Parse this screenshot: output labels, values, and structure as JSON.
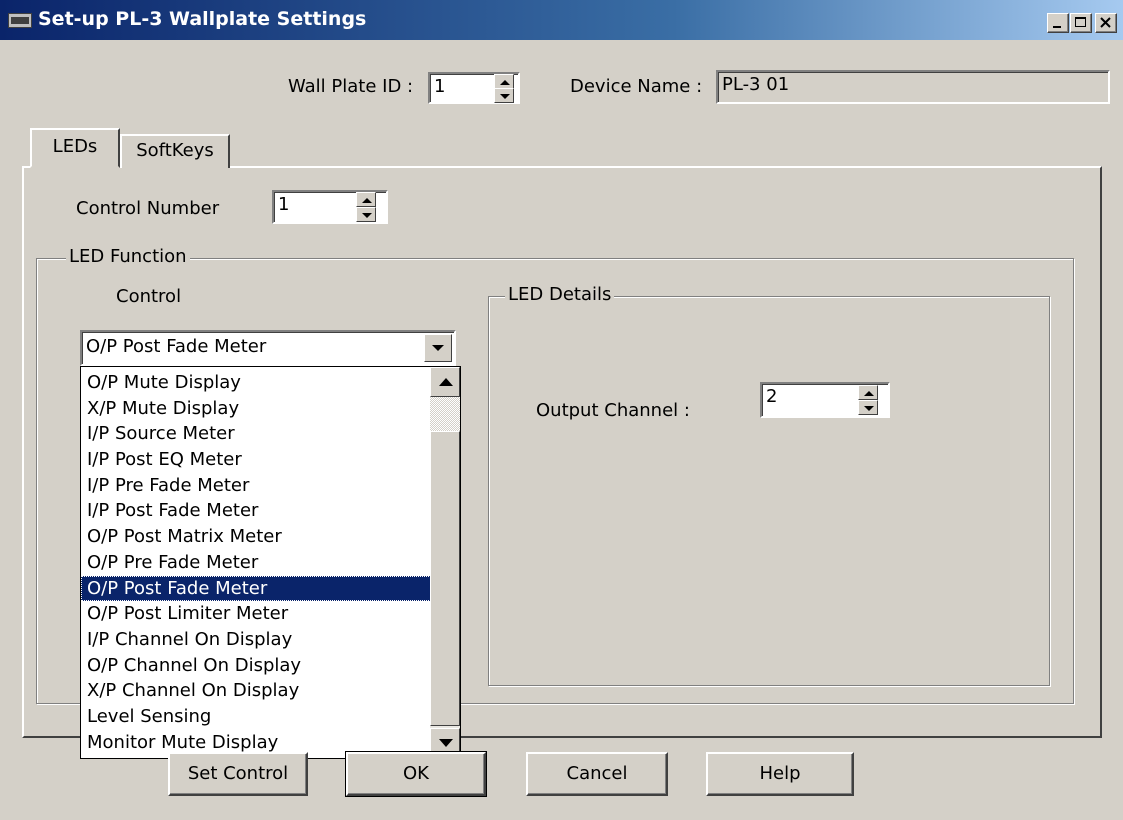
{
  "window": {
    "title": "Set-up PL-3 Wallplate Settings",
    "icon": "keyboard-icon",
    "controls": [
      "minimize-icon",
      "maximize-icon",
      "close-icon"
    ]
  },
  "header": {
    "wall_plate_label": "Wall Plate ID :",
    "wall_plate_value": "1",
    "device_name_label": "Device Name :",
    "device_name_value": "PL-3 01"
  },
  "tabs": [
    {
      "label": "LEDs",
      "active": true
    },
    {
      "label": "SoftKeys",
      "active": false
    }
  ],
  "leds": {
    "control_number_label": "Control Number",
    "control_number_value": "1",
    "led_function_title": "LED Function",
    "control_label": "Control",
    "control_selected": "O/P Post Fade Meter",
    "options": [
      "O/P Mute Display",
      "X/P Mute Display",
      "I/P Source Meter",
      "I/P Post EQ Meter",
      "I/P Pre Fade Meter",
      "I/P Post Fade Meter",
      "O/P Post Matrix Meter",
      "O/P Pre Fade Meter",
      "O/P Post Fade Meter",
      "O/P Post Limiter Meter",
      "I/P Channel On Display",
      "O/P Channel On Display",
      "X/P Channel On Display",
      "Level Sensing",
      "Monitor Mute Display"
    ],
    "selected_index": 8,
    "led_details_title": "LED Details",
    "output_channel_label": "Output Channel :",
    "output_channel_value": "2"
  },
  "buttons": {
    "set_control": "Set Control",
    "ok": "OK",
    "cancel": "Cancel",
    "help": "Help"
  },
  "colors": {
    "face": "#d4d0c8",
    "title_bar": "#0a246a",
    "selection": "#0a246a"
  }
}
